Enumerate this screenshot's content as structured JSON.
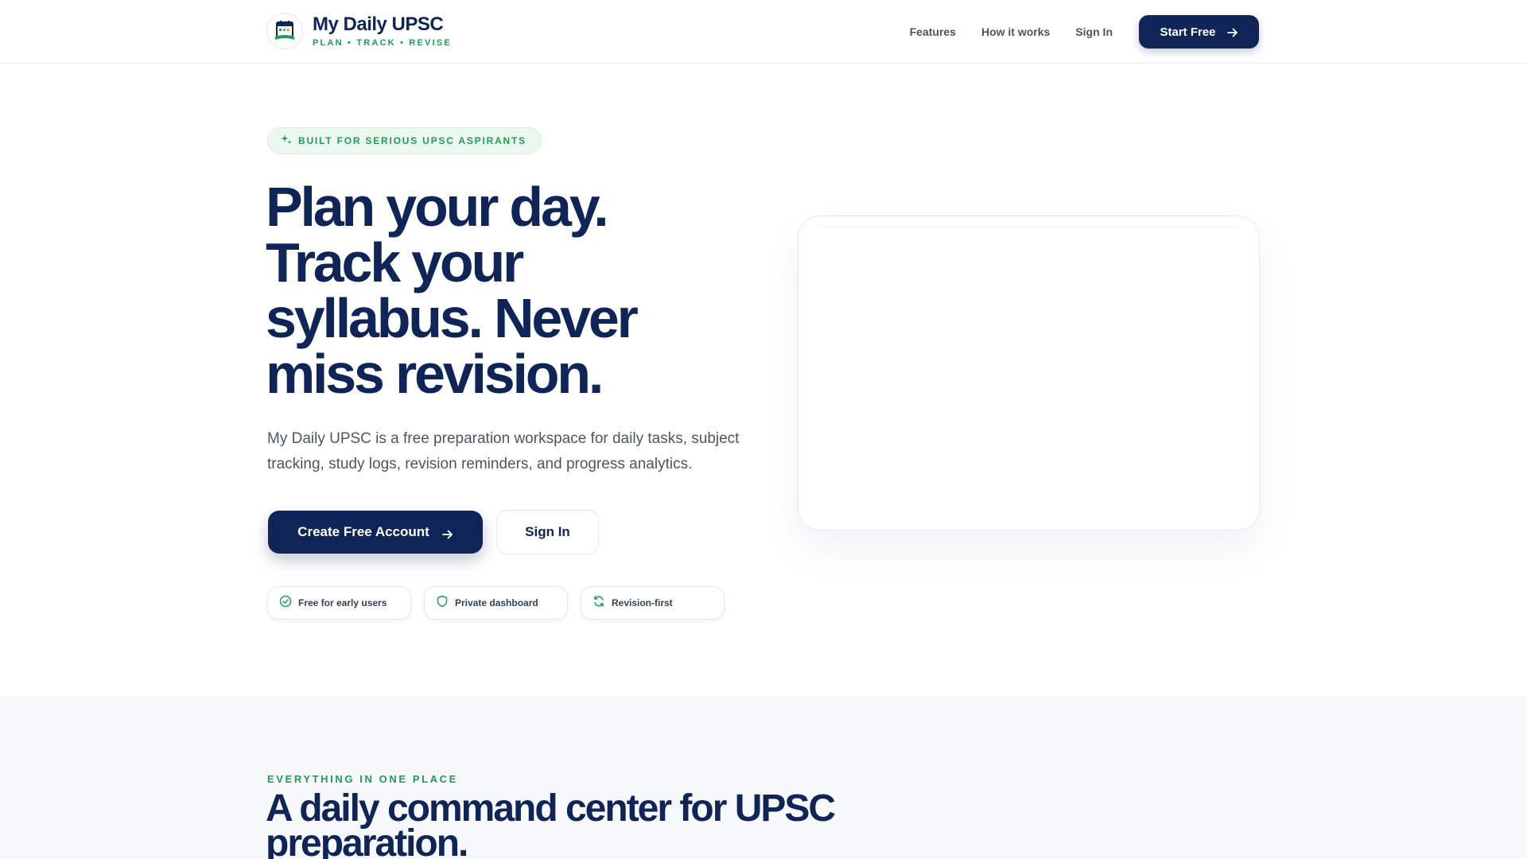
{
  "brand": {
    "title": "My Daily UPSC",
    "tagline": "PLAN • TRACK • REVISE"
  },
  "nav": {
    "features": "Features",
    "how_it_works": "How it works",
    "sign_in": "Sign In",
    "start_free": "Start Free"
  },
  "hero": {
    "pill": "BUILT FOR SERIOUS UPSC ASPIRANTS",
    "headline_lines": [
      "Plan your day.",
      "Track your",
      "syllabus. Never",
      "miss revision."
    ],
    "subtext": "My Daily UPSC is a free preparation workspace for daily tasks, subject tracking, study logs, revision reminders, and progress analytics.",
    "cta_primary": "Create Free Account",
    "cta_secondary": "Sign In",
    "chips": [
      {
        "label": "Free for early users",
        "icon": "check-circle-icon"
      },
      {
        "label": "Private dashboard",
        "icon": "shield-icon"
      },
      {
        "label": "Revision-first",
        "icon": "refresh-icon"
      }
    ]
  },
  "features_section": {
    "eyebrow": "EVERYTHING IN ONE PLACE",
    "title": "A daily command center for UPSC preparation."
  },
  "colors": {
    "navy": "#0f2557",
    "green": "#1f9d55",
    "section_bg": "#f7f8fa"
  }
}
